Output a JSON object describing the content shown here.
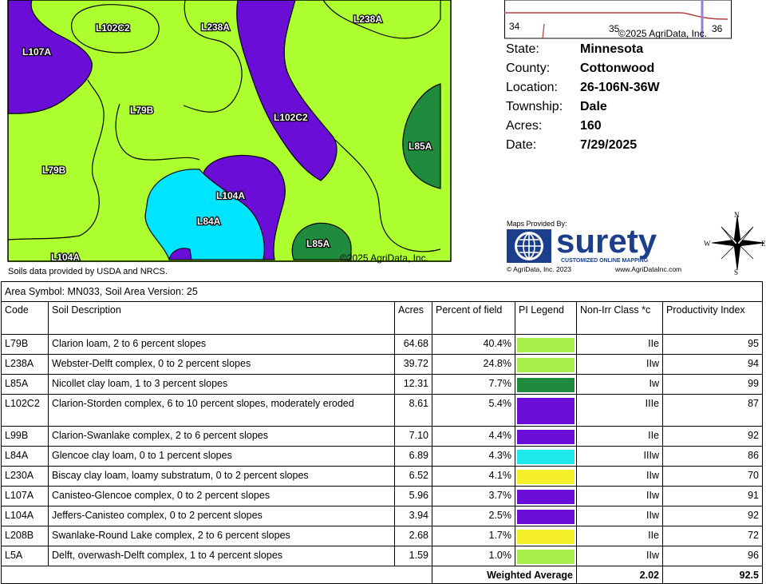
{
  "map": {
    "labels": {
      "l102c2_a": "L102C2",
      "l238a_a": "L238A",
      "l238a_b": "L238A",
      "l107a": "L107A",
      "l79b_a": "L79B",
      "l102c2_b": "L102C2",
      "l85a_a": "L85A",
      "l79b_b": "L79B",
      "l104a_a": "L104A",
      "l84a": "L84A",
      "l85a_b": "L85A",
      "l104a_b": "L104A"
    },
    "copyright": "©2025 AgriData, Inc.",
    "colors": {
      "L79B": "#adff2f",
      "L102C2": "#6a0dd6",
      "L84A": "#00e5ff",
      "L85A": "#1f8b3c"
    }
  },
  "source_note": "Soils data provided by USDA and NRCS.",
  "inset": {
    "section_left": "34",
    "section_mid": "35",
    "section_right": "36",
    "copyright": "©2025 AgriData, Inc."
  },
  "info": [
    {
      "key": "State:",
      "value": "Minnesota"
    },
    {
      "key": "County:",
      "value": "Cottonwood"
    },
    {
      "key": "Location:",
      "value": "26-106N-36W"
    },
    {
      "key": "Township:",
      "value": "Dale"
    },
    {
      "key": "Acres:",
      "value": "160"
    },
    {
      "key": "Date:",
      "value": "7/29/2025"
    }
  ],
  "logo": {
    "provided_by": "Maps Provided By:",
    "brand": "surety",
    "tagline": "CUSTOMIZED ONLINE MAPPING",
    "copyright": "© AgriData, Inc. 2023",
    "url": "www.AgriDataInc.com"
  },
  "compass": {
    "n": "N",
    "s": "S",
    "e": "E",
    "w": "W"
  },
  "table": {
    "area_symbol": "Area Symbol: MN033, Soil Area Version: 25",
    "headers": [
      "Code",
      "Soil Description",
      "Acres",
      "Percent of field",
      "PI Legend",
      "Non-Irr Class *c",
      "Productivity Index"
    ],
    "rows": [
      {
        "code": "L79B",
        "desc": "Clarion loam, 2 to 6 percent slopes",
        "acres": "64.68",
        "pct": "40.4%",
        "color": "#a8f04c",
        "cls": "IIe",
        "pi": "95"
      },
      {
        "code": "L238A",
        "desc": "Webster-Delft complex, 0 to 2 percent slopes",
        "acres": "39.72",
        "pct": "24.8%",
        "color": "#a8f04c",
        "cls": "IIw",
        "pi": "94"
      },
      {
        "code": "L85A",
        "desc": "Nicollet clay loam, 1 to 3 percent slopes",
        "acres": "12.31",
        "pct": "7.7%",
        "color": "#1f8b3c",
        "cls": "Iw",
        "pi": "99"
      },
      {
        "code": "L102C2",
        "desc": "Clarion-Storden complex, 6 to 10 percent slopes, moderately eroded",
        "acres": "8.61",
        "pct": "5.4%",
        "color": "#6a0dd6",
        "cls": "IIIe",
        "pi": "87"
      },
      {
        "code": "L99B",
        "desc": "Clarion-Swanlake complex, 2 to 6 percent slopes",
        "acres": "7.10",
        "pct": "4.4%",
        "color": "#6a0dd6",
        "cls": "IIe",
        "pi": "92"
      },
      {
        "code": "L84A",
        "desc": "Glencoe clay loam, 0 to 1 percent slopes",
        "acres": "6.89",
        "pct": "4.3%",
        "color": "#1de9ea",
        "cls": "IIIw",
        "pi": "86"
      },
      {
        "code": "L230A",
        "desc": "Biscay clay loam, loamy substratum, 0 to 2 percent slopes",
        "acres": "6.52",
        "pct": "4.1%",
        "color": "#f5ef2a",
        "cls": "IIw",
        "pi": "70"
      },
      {
        "code": "L107A",
        "desc": "Canisteo-Glencoe complex, 0 to 2 percent slopes",
        "acres": "5.96",
        "pct": "3.7%",
        "color": "#6a0dd6",
        "cls": "IIw",
        "pi": "91"
      },
      {
        "code": "L104A",
        "desc": "Jeffers-Canisteo complex, 0 to 2 percent slopes",
        "acres": "3.94",
        "pct": "2.5%",
        "color": "#6a0dd6",
        "cls": "IIw",
        "pi": "92"
      },
      {
        "code": "L208B",
        "desc": "Swanlake-Round Lake complex, 2 to 6 percent slopes",
        "acres": "2.68",
        "pct": "1.7%",
        "color": "#f5ef2a",
        "cls": "IIe",
        "pi": "72"
      },
      {
        "code": "L5A",
        "desc": "Delft, overwash-Delft complex, 1 to 4 percent slopes",
        "acres": "1.59",
        "pct": "1.0%",
        "color": "#a8f04c",
        "cls": "IIw",
        "pi": "96"
      }
    ],
    "weighted_label": "Weighted Average",
    "weighted_class": "2.02",
    "weighted_pi": "92.5"
  }
}
